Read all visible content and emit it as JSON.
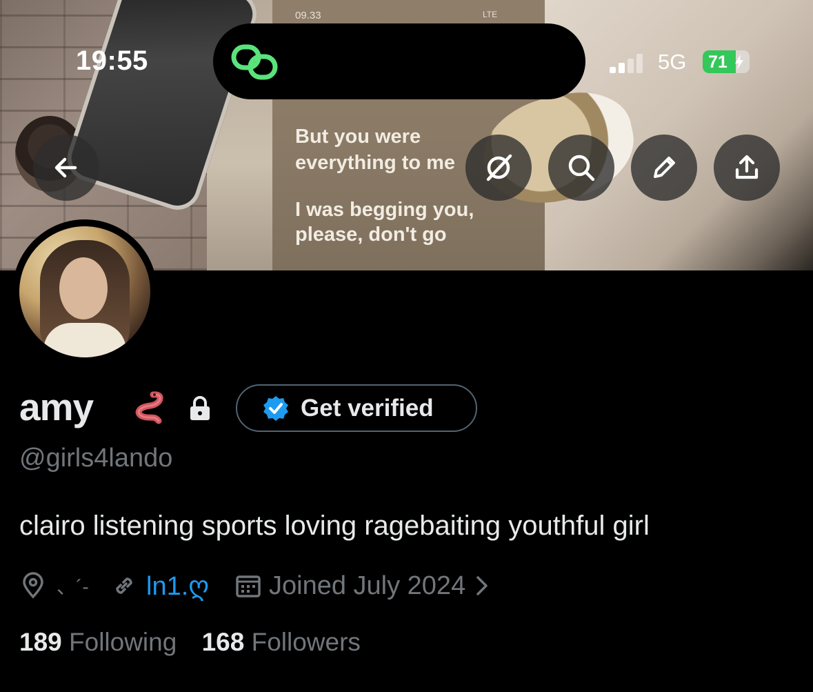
{
  "status_bar": {
    "time": "19:55",
    "network": "5G",
    "battery": "71",
    "battery_level": 0.71
  },
  "banner": {
    "phone_status_time": "09.33",
    "phone_status_right": "LTE",
    "lyrics": [
      "But you were",
      "everything to me",
      "I was begging you,",
      "please, don't go"
    ]
  },
  "header_buttons": {
    "back": "back-arrow-icon",
    "grok": "grok-icon",
    "search": "search-icon",
    "edit": "pencil-icon",
    "share": "share-icon"
  },
  "profile": {
    "name": "amy",
    "name_emoji": "worm",
    "verify_button": "Get verified",
    "handle": "@girls4lando",
    "bio": "clairo listening sports loving ragebaiting youthful girl",
    "location": "、´-",
    "link": "ln1.ღ",
    "joined": "Joined July 2024",
    "following_count": "189",
    "following_label": "Following",
    "followers_count": "168",
    "followers_label": "Followers"
  },
  "colors": {
    "background": "#000000",
    "text_primary": "#e7e9ea",
    "text_secondary": "#71767b",
    "link": "#1d9bf0",
    "verified_badge": "#1d9bf0",
    "battery_green": "#34c759",
    "island_icon_green": "#5be37b"
  }
}
